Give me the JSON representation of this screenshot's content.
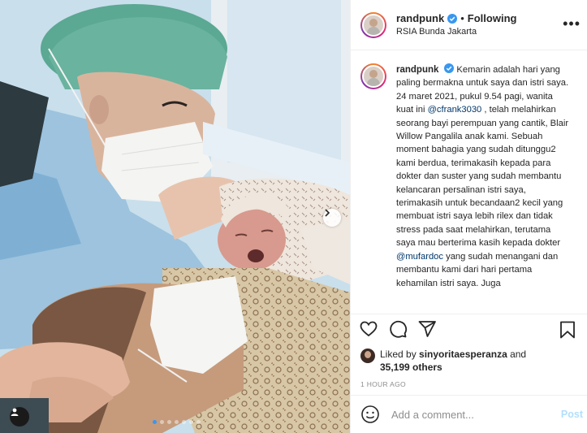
{
  "post": {
    "username": "randpunk",
    "verified": true,
    "separator": "•",
    "follow_status": "Following",
    "location": "RSIA Bunda Jakarta",
    "more_label": "•••"
  },
  "caption": {
    "username": "randpunk",
    "text_part1": "Kemarin adalah hari yang paling bermakna untuk saya dan istri saya. 24 maret 2021, pukul 9.54 pagi, wanita kuat ini ",
    "mention1": "@cfrank3030",
    "text_part2": " , telah melahirkan seorang bayi perempuan yang cantik, Blair Willow Pangalila anak kami. Sebuah moment bahagia yang sudah ditunggu2 kami berdua, terimakasih kepada para dokter dan suster yang sudah membantu kelancaran persalinan istri saya, terimakasih untuk becandaan2 kecil yang membuat istri saya lebih rilex dan tidak stress pada saat melahirkan, terutama saya mau berterima kasih kepada dokter ",
    "mention2": "@mufardoc",
    "text_part3": " yang sudah menangani dan membantu kami dari hari pertama kehamilan istri saya. Juga"
  },
  "likes": {
    "prefix": "Liked by ",
    "first_user": "sinyoritaesperanza",
    "connector": " and",
    "count_text": "35,199 others"
  },
  "timestamp": "1 HOUR AGO",
  "comment_box": {
    "placeholder": "Add a comment...",
    "post_label": "Post"
  },
  "carousel": {
    "total_slides": 7,
    "active_index": 0
  },
  "icons": {
    "like": "heart-icon",
    "comment": "comment-icon",
    "share": "paper-plane-icon",
    "save": "bookmark-icon",
    "emoji": "smiley-icon",
    "next": "chevron-right-icon",
    "tags": "user-tag-icon",
    "verified": "verified-badge-icon"
  },
  "colors": {
    "verified_blue": "#3897f0",
    "mention": "#00376b",
    "post_disabled": "#b2dffc",
    "muted": "#8e8e8e"
  }
}
